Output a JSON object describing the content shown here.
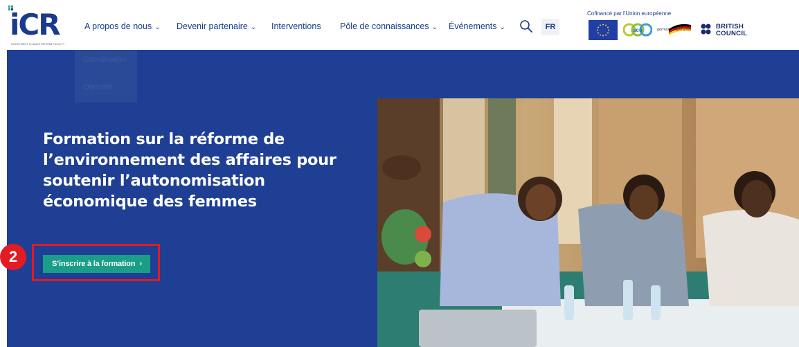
{
  "header": {
    "logo_text": "iCR",
    "logo_subtitle": "INVESTMENT CLIMATE REFORM FACILITY",
    "nav": [
      {
        "label": "A propos de nous",
        "has_dropdown": true
      },
      {
        "label": "Devenir partenaire",
        "has_dropdown": true
      },
      {
        "label": "Interventions",
        "has_dropdown": false
      },
      {
        "label": "Pôle de connaissances",
        "has_dropdown": true
      },
      {
        "label": "Événements",
        "has_dropdown": true
      }
    ],
    "dropdown_chevron": "⌄",
    "search_icon": "search-icon",
    "language": "FR",
    "cofinance_text": "Cofinancé par l'Union européenne",
    "partners": {
      "aco_text": "aco",
      "giz_text": "german cooperation",
      "british_council_line1": "BRITISH",
      "british_council_line2": "COUNCIL"
    }
  },
  "dropdown_ghost": {
    "item1": "Coordination",
    "item2": "Objectifs"
  },
  "hero": {
    "title": "Formation sur la réforme de l’environnement des affaires pour soutenir l’autonomisation économique des femmes",
    "cta_label": "S’inscrire à la formation",
    "cta_chevron": "›",
    "step_number": "2"
  },
  "colors": {
    "brand_blue": "#1e3f93",
    "accent_teal": "#1a9e8a",
    "highlight_red": "#e31b23"
  }
}
